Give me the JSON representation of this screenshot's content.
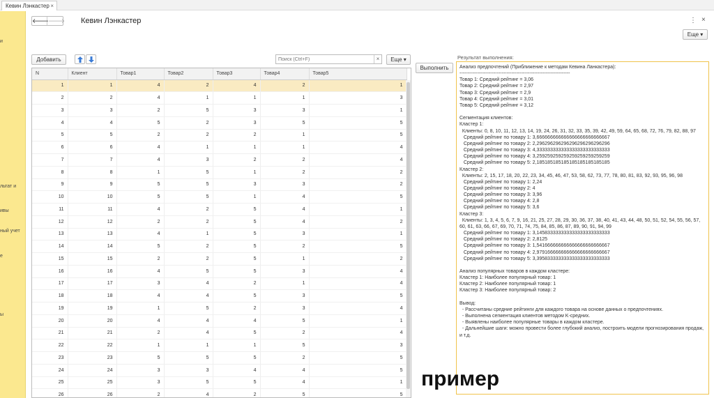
{
  "tab": {
    "title": "Кевин Лэнкастер",
    "close": "×"
  },
  "sidebar": {
    "items": [
      "и",
      "льтат и",
      "ивы",
      "ный учет",
      "е",
      "ы"
    ]
  },
  "header": {
    "title": "Кевин Лэнкастер",
    "back": "🡐",
    "forward": "🡒",
    "kebab": "⋮",
    "close": "×",
    "more_label": "Еще ▾"
  },
  "toolbar": {
    "add_label": "Добавить",
    "search_placeholder": "Поиск (Ctrl+F)",
    "clear": "×",
    "more_label": "Еще ▾",
    "execute_label": "Выполнить"
  },
  "table": {
    "columns": [
      "N",
      "Клиент",
      "Товар1",
      "Товар2",
      "Товар3",
      "Товар4",
      "Товар5"
    ],
    "rows": [
      [
        1,
        1,
        4,
        2,
        4,
        2,
        1
      ],
      [
        2,
        2,
        4,
        1,
        1,
        1,
        3
      ],
      [
        3,
        3,
        2,
        5,
        3,
        3,
        1
      ],
      [
        4,
        4,
        5,
        2,
        3,
        5,
        5
      ],
      [
        5,
        5,
        2,
        2,
        2,
        1,
        5
      ],
      [
        6,
        6,
        4,
        1,
        1,
        1,
        4
      ],
      [
        7,
        7,
        4,
        3,
        2,
        2,
        4
      ],
      [
        8,
        8,
        1,
        5,
        1,
        2,
        2
      ],
      [
        9,
        9,
        5,
        5,
        3,
        3,
        2
      ],
      [
        10,
        10,
        5,
        5,
        1,
        4,
        5
      ],
      [
        11,
        11,
        4,
        2,
        5,
        4,
        1
      ],
      [
        12,
        12,
        2,
        2,
        5,
        4,
        2
      ],
      [
        13,
        13,
        4,
        1,
        5,
        3,
        1
      ],
      [
        14,
        14,
        5,
        2,
        5,
        2,
        5
      ],
      [
        15,
        15,
        2,
        2,
        5,
        1,
        2
      ],
      [
        16,
        16,
        4,
        5,
        5,
        3,
        4
      ],
      [
        17,
        17,
        3,
        4,
        2,
        1,
        4
      ],
      [
        18,
        18,
        4,
        4,
        5,
        3,
        5
      ],
      [
        19,
        19,
        1,
        5,
        2,
        3,
        4
      ],
      [
        20,
        20,
        4,
        4,
        4,
        5,
        1
      ],
      [
        21,
        21,
        2,
        4,
        5,
        2,
        4
      ],
      [
        22,
        22,
        1,
        1,
        1,
        5,
        3
      ],
      [
        23,
        23,
        5,
        5,
        5,
        2,
        5
      ],
      [
        24,
        24,
        3,
        3,
        4,
        4,
        5
      ],
      [
        25,
        25,
        3,
        5,
        5,
        4,
        1
      ],
      [
        26,
        26,
        2,
        4,
        2,
        5,
        5
      ]
    ],
    "selected_row": 0
  },
  "result": {
    "label": "Результат выполнения:",
    "text": "Анализ предпочтений (Приближение к методам Кевина Ланкастера):\n--------------------------------------------------------------------\nТовар 1: Средний рейтинг = 3,06\nТовар 2: Средний рейтинг = 2,97\nТовар 3: Средний рейтинг = 2,9\nТовар 4: Средний рейтинг = 3,01\nТовар 5: Средний рейтинг = 3,12\n\nСегментация клиентов:\nКластер 1:\n  Клиенты: 0, 8, 10, 11, 12, 13, 14, 19, 24, 26, 31, 32, 33, 35, 39, 42, 49, 59, 64, 65, 68, 72, 76, 79, 82, 88, 97\n   Средний рейтинг по товару 1: 3,666666666666666666666666667\n   Средний рейтинг по товару 2: 2,296296296296296296296296296\n   Средний рейтинг по товару 3: 4,333333333333333333333333333\n   Средний рейтинг по товару 4: 3,259259259259259259259259259\n   Средний рейтинг по товару 5: 2,185185185185185185185185185\nКластер 2:\n  Клиенты: 2, 15, 17, 18, 20, 22, 23, 34, 45, 46, 47, 53, 58, 62, 73, 77, 78, 80, 81, 83, 92, 93, 95, 96, 98\n   Средний рейтинг по товару 1: 2,24\n   Средний рейтинг по товару 2: 4\n   Средний рейтинг по товару 3: 3,96\n   Средний рейтинг по товару 4: 2,8\n   Средний рейтинг по товару 5: 3,6\nКластер 3:\n  Клиенты: 1, 3, 4, 5, 6, 7, 9, 16, 21, 25, 27, 28, 29, 30, 36, 37, 38, 40, 41, 43, 44, 48, 50, 51, 52, 54, 55, 56, 57, 60, 61, 63, 66, 67, 69, 70, 71, 74, 75, 84, 85, 86, 87, 89, 90, 91, 94, 99\n   Средний рейтинг по товару 1: 3,145833333333333333333333333\n   Средний рейтинг по товару 2: 2,8125\n   Средний рейтинг по товару 3: 1,541666666666666666666666667\n   Средний рейтинг по товару 4: 2,979166666666666666666666667\n   Средний рейтинг по товару 5: 3,395833333333333333333333333\n\nАнализ популярных товаров в каждом кластере:\nКластер 1: Наиболее популярный товар: 1\nКластер 2: Наиболее популярный товар: 1\nКластер 3: Наиболее популярный товар: 2\n\nВывод:\n  - Рассчитаны средние рейтинги для каждого товара на основе данных о предпочтениях.\n  - Выполнена сегментация клиентов методом K-средних.\n  - Выявлены наиболее популярные товары в каждом кластере.\n  - Дальнейшие шаги: можно провести более глубокий анализ, построить модели прогнозирования продаж, и т.д."
  },
  "watermark": "пример",
  "colors": {
    "sidebar": "#fbe88f",
    "selected_row": "#faebc2",
    "result_border": "#f0c34a",
    "arrow_blue": "#3a7bd5"
  }
}
